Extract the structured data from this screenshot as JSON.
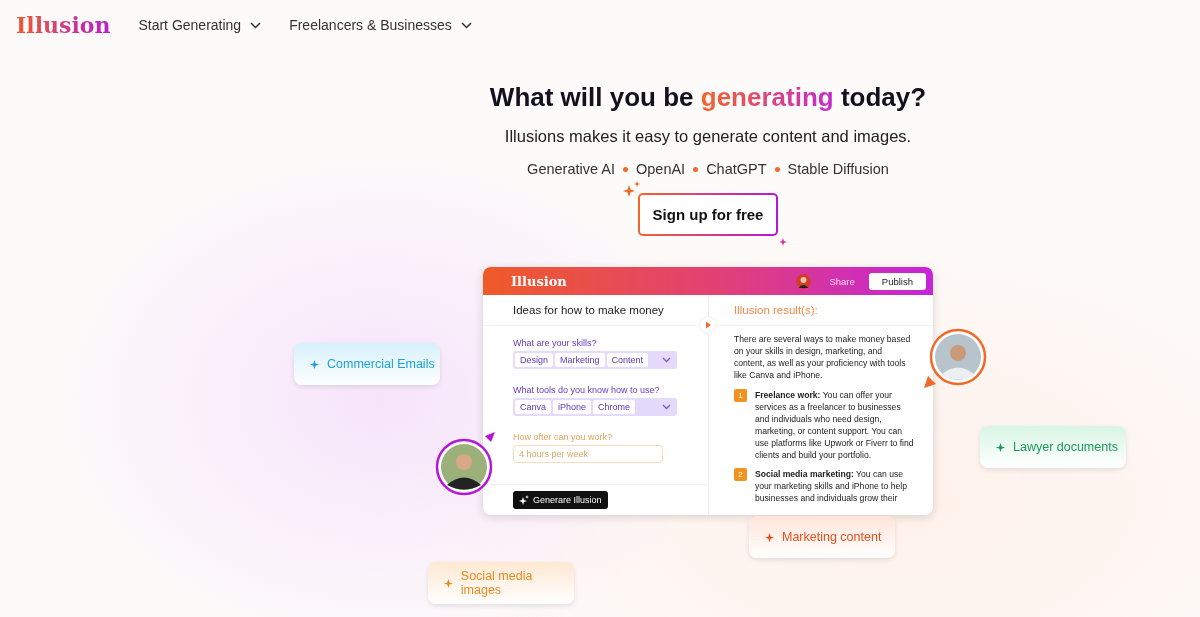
{
  "nav": {
    "logo": "Illusion",
    "items": [
      {
        "label": "Start Generating"
      },
      {
        "label": "Freelancers & Businesses"
      }
    ]
  },
  "hero": {
    "title_before": "What will you be ",
    "title_highlight": "generating",
    "title_after": " today?",
    "subtitle": "Illusions makes it easy to generate content and images.",
    "tags": [
      "Generative AI",
      "OpenAI",
      "ChatGPT",
      "Stable Diffusion"
    ],
    "cta": "Sign up for free"
  },
  "mockup": {
    "logo": "Illusion",
    "share": "Share",
    "publish": "Publish",
    "left": {
      "title": "Ideas for how to make money",
      "fields": [
        {
          "kind": "chips",
          "label": "What are your skills?",
          "chips": [
            "Design",
            "Marketing",
            "Content"
          ]
        },
        {
          "kind": "chips",
          "label": "What tools do you know how to use?",
          "chips": [
            "Canva",
            "iPhone",
            "Chrome"
          ]
        },
        {
          "kind": "text",
          "label": "How ofter can you work?",
          "placeholder": "4 hours per week"
        }
      ],
      "button": "Generare Illusion"
    },
    "right": {
      "title": "Illusion result(s):",
      "intro": "There are several ways to make money based on your skills in design, marketing, and content, as well as your proficiency with tools like Canva and iPhone.",
      "items": [
        {
          "number": "1",
          "text": "**Freelance work:** You can offer your services as a freelancer to businesses and individuals who need design, marketing, or content support. You can use platforms like Upwork or Fiverr to find clients and build your portfolio."
        },
        {
          "number": "2",
          "text": "**Social media marketing:** You can use your marketing skills and iPhone to help businesses and individuals grow their"
        }
      ]
    }
  },
  "chips": [
    {
      "label": "Commercial Emails",
      "color": "#1aa3d9"
    },
    {
      "label": "Lawyer documents",
      "color": "#1f9a5a"
    },
    {
      "label": "Marketing content",
      "color": "#e8501e"
    },
    {
      "label": "Social media images",
      "color": "#e88a1e"
    }
  ]
}
